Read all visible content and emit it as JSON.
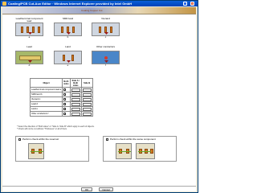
{
  "window": {
    "title": "Coating/PCB Cut-Aux Editor · Windows Internet Explorer provided by Intel GmbH"
  },
  "banner": {
    "title": "Coating Copper Cut"
  },
  "gallery": {
    "tiles": [
      {
        "label": "Lead/terminal component lead",
        "sub": "a"
      },
      {
        "label": "SMD land",
        "sub": "b"
      },
      {
        "label": "Via land",
        "sub": "c"
      },
      {
        "label": "Lead",
        "sub": "d"
      },
      {
        "label": "Land",
        "sub": "e"
      },
      {
        "label": "Other conductors",
        "sub": "f"
      }
    ]
  },
  "table": {
    "headers": [
      "Object",
      "Both sides",
      "Side A / Both sides",
      "Side B"
    ],
    "rows": [
      {
        "label": "Lead/terminal component lead a"
      },
      {
        "label": "SMD land b"
      },
      {
        "label": "Via land c"
      },
      {
        "label": "Lead d"
      },
      {
        "label": "Land e"
      },
      {
        "label": "Other conductors f"
      }
    ]
  },
  "notes": [
    "* Select the direction of \"Both sides\" or \"Side A / Side B\" which apply to each of objects.",
    "* Check will not be cut without \"Thickness\" or all of them."
  ],
  "options": {
    "left_label": "Perform check within the reservoir",
    "right_label": "Perform check within the same component"
  },
  "footer": {
    "ok_label": "OK",
    "cancel_label": "Cancel"
  }
}
